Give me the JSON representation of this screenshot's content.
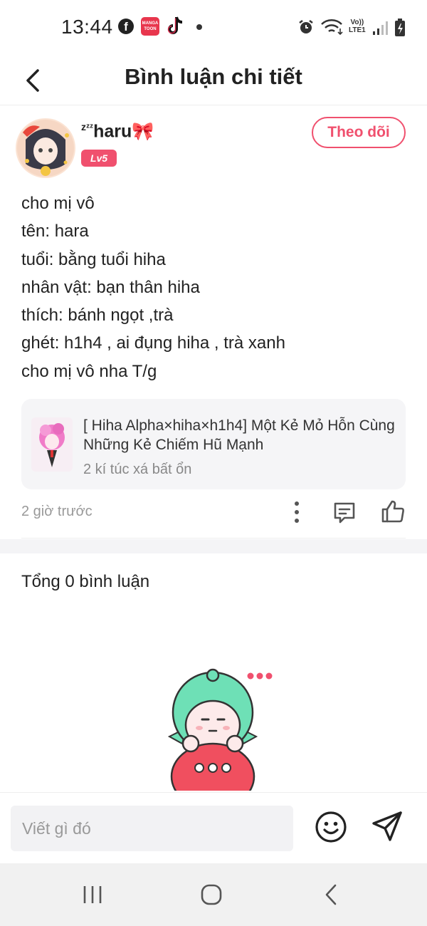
{
  "status_bar": {
    "time": "13:44",
    "fb_letter": "f",
    "app_badge": "MANGA TOON",
    "lte_top": "Vo))",
    "lte_bottom": "LTE1"
  },
  "header": {
    "title": "Bình luận chi tiết"
  },
  "user": {
    "name": "haru🎀",
    "name_prefix": "zᶻᶻ",
    "level": "Lv5",
    "follow_label": "Theo dõi"
  },
  "comment": {
    "lines": [
      "cho mị vô",
      "tên: hara",
      "tuổi: bằng tuổi hiha",
      "nhân vật: bạn thân hiha",
      "thích: bánh ngọt ,trà",
      "ghét: h1h4 , ai đụng hiha , trà xanh",
      "cho mị vô nha T/g"
    ],
    "timestamp": "2 giờ trước"
  },
  "story": {
    "title": "[ Hiha Alpha×hiha×h1h4] Một Kẻ Mỏ Hỗn Cùng Những Kẻ Chiếm Hũ Mạnh",
    "subtitle": "2 kí túc xá bất ổn"
  },
  "comments_section": {
    "total": "Tổng 0 bình luận"
  },
  "input": {
    "placeholder": "Viết gì đó"
  },
  "icons": {
    "back": "back-arrow-icon",
    "more": "more-vertical-icon",
    "reply": "comment-icon",
    "like": "thumbs-up-icon",
    "emoji": "smiley-icon",
    "send": "send-icon"
  },
  "colors": {
    "accent": "#f0506e",
    "muted_text": "#999999",
    "card_bg": "#f5f5f7"
  }
}
